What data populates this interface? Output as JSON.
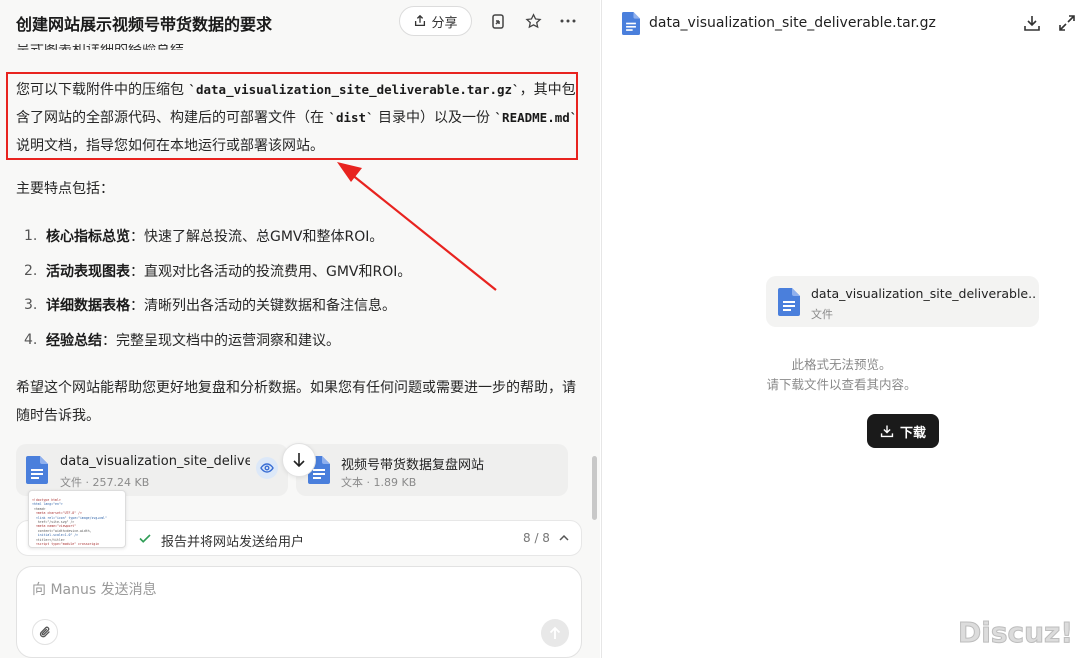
{
  "header": {
    "title": "创建网站展示视频号带货数据的要求",
    "share_label": "分享"
  },
  "chat": {
    "cut_line": "呈式图表和详细的经验总结。",
    "download_para": {
      "t1": "您可以下载附件中的压缩包 ",
      "c1": "`data_visualization_site_deliverable.tar.gz`",
      "t2": "，其中包含了网站的全部源代码、构建后的可部署文件（在 ",
      "c2": "`dist`",
      "t3": " 目录中）以及一份 ",
      "c3": "`README.md`",
      "t4": " 说明文档，指导您如何在本地运行或部署该网站。"
    },
    "features_intro": "主要特点包括：",
    "features": [
      {
        "num": "1.",
        "title": "核心指标总览",
        "desc": "：快速了解总投流、总GMV和整体ROI。"
      },
      {
        "num": "2.",
        "title": "活动表现图表",
        "desc": "：直观对比各活动的投流费用、GMV和ROI。"
      },
      {
        "num": "3.",
        "title": "详细数据表格",
        "desc": "：清晰列出各活动的关键数据和备注信息。"
      },
      {
        "num": "4.",
        "title": "经验总结",
        "desc": "：完整呈现文档中的运营洞察和建议。"
      }
    ],
    "closing": "希望这个网站能帮助您更好地复盘和分析数据。如果您有任何问题或需要进一步的帮助，请随时告诉我。",
    "attachments": [
      {
        "name": "data_visualization_site_deliver...",
        "meta": "文件 · 257.24 KB"
      },
      {
        "name": "视频号带货数据复盘网站",
        "meta": "文本 · 1.89 KB"
      }
    ],
    "task_progress": {
      "label": "报告并将网站发送给用户",
      "count": "8 / 8"
    },
    "composer_placeholder": "向 Manus 发送消息"
  },
  "preview": {
    "title": "data_visualization_site_deliverable.tar.gz",
    "card_name": "data_visualization_site_deliverable....",
    "card_type": "文件",
    "msg_line1": "此格式无法预览。",
    "msg_line2": "请下载文件以查看其内容。",
    "download_label": "下载"
  },
  "watermark": "Discuz!",
  "colors": {
    "accent_red": "#e8231f",
    "doc_blue": "#4a7fdc",
    "check_green": "#2f9d56",
    "download_btn": "#1a1a1a"
  }
}
